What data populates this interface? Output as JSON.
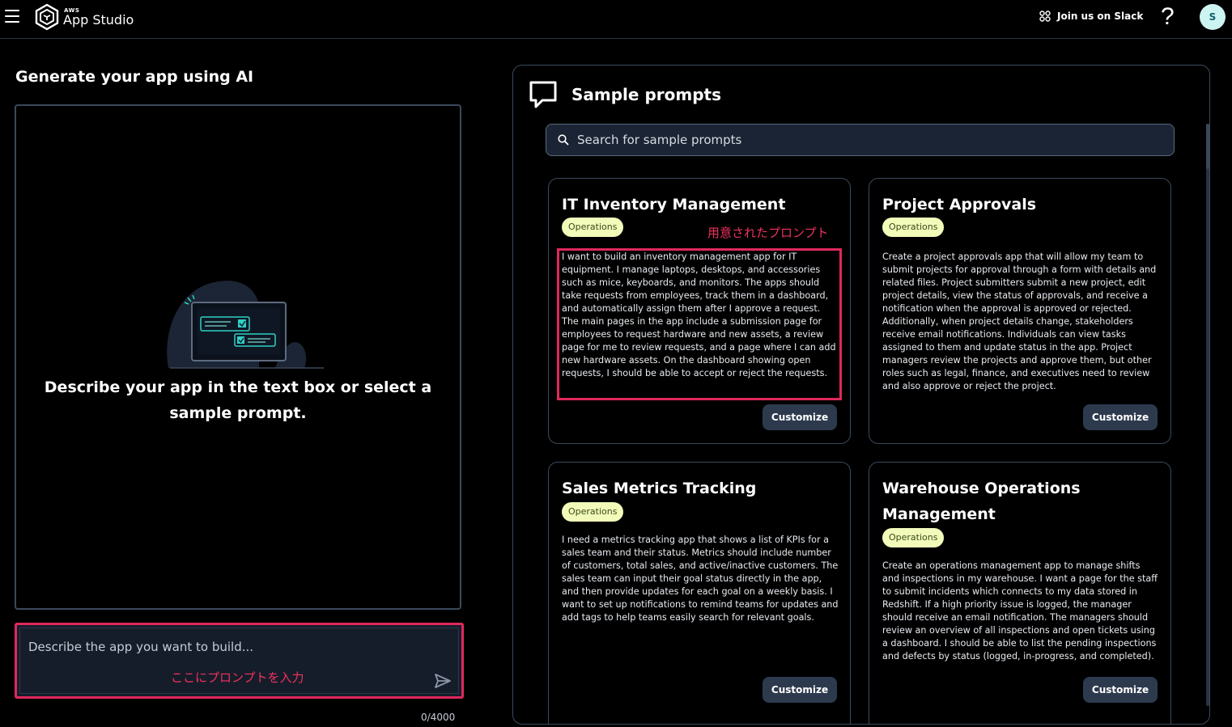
{
  "header": {
    "brand_small": "AWS",
    "brand_main": "App Studio",
    "slack_label": "Join us on Slack",
    "help_label": "?",
    "avatar_initial": "S"
  },
  "left": {
    "title": "Generate your app using AI",
    "empty_state": "Describe your app in the text box or select a sample prompt.",
    "input_placeholder": "Describe the app you want to build...",
    "input_annotation": "ここにプロンプトを入力",
    "counter": "0/4000"
  },
  "right": {
    "title": "Sample prompts",
    "search_placeholder": "Search for sample prompts",
    "prompt_annotation": "用意されたプロンプト",
    "cards": [
      {
        "title": "IT Inventory Management",
        "badge": "Operations",
        "description": "I want to build an inventory management app for IT equipment. I manage laptops, desktops, and accessories such as mice, keyboards, and monitors. The apps should take requests from employees, track them in a dashboard, and automatically assign them after I approve a request. The main pages in the app include a submission page for employees to request hardware and new assets, a review page for me to review requests, and a page where I can add new hardware assets. On the dashboard showing open requests, I should be able to accept or reject the requests.",
        "button": "Customize"
      },
      {
        "title": "Project Approvals",
        "badge": "Operations",
        "description": "Create a project approvals app that will allow my team to submit projects for approval through a form with details and related files. Project submitters submit a new project, edit project details, view the status of approvals, and receive a notification when the approval is approved or rejected. Additionally, when project details change, stakeholders receive email notifications. Individuals can view tasks assigned to them and update status in the app. Project managers review the projects and approve them, but other roles such as legal, finance, and executives need to review and also approve or reject the project.",
        "button": "Customize"
      },
      {
        "title": "Sales Metrics Tracking",
        "badge": "Operations",
        "description": "I need a metrics tracking app that shows a list of KPIs for a sales team and their status. Metrics should include number of customers, total sales, and active/inactive customers. The sales team can input their goal status directly in the app, and then provide updates for each goal on a weekly basis. I want to set up notifications to remind teams for updates and add tags to help teams easily search for relevant goals.",
        "button": "Customize"
      },
      {
        "title": "Warehouse Operations Management",
        "badge": "Operations",
        "description": "Create an operations management app to manage shifts and inspections in my warehouse. I want a page for the staff to submit incidents which connects to my data stored in Redshift. If a high priority issue is logged, the manager should receive an email notification. The managers should review an overview of all inspections and open tickets using a dashboard. I should be able to list the pending inspections and defects by status (logged, in-progress, and completed).",
        "button": "Customize"
      }
    ]
  },
  "colors": {
    "accent_red": "#e0285c",
    "badge_bg": "#f2fbb9",
    "avatar_bg": "#ccf5f2",
    "button_bg": "#2d3a4e"
  }
}
